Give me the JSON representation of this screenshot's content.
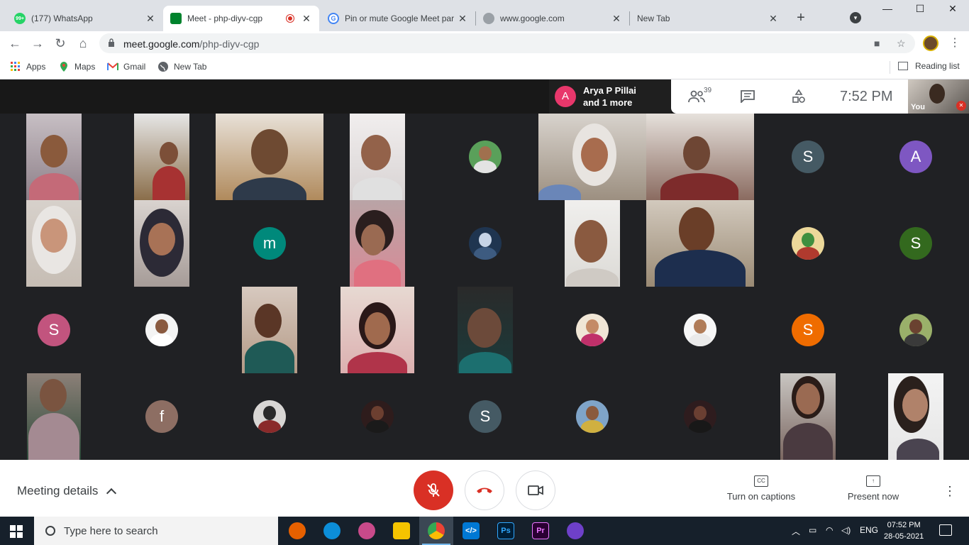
{
  "browser": {
    "tabs": [
      {
        "title": "(177) WhatsApp",
        "favicon": "whatsapp-icon",
        "favicon_color": "#25d366",
        "favicon_text": "99+"
      },
      {
        "title": "Meet - php-diyv-cgp",
        "favicon": "meet-icon",
        "favicon_color": "#00832d"
      },
      {
        "title": "Pin or mute Google Meet par",
        "favicon": "google-icon",
        "favicon_color": "#4285f4"
      },
      {
        "title": "www.google.com",
        "favicon": "globe-icon",
        "favicon_color": "#5f6368"
      },
      {
        "title": "New Tab",
        "favicon": "",
        "favicon_color": ""
      }
    ],
    "url_host": "meet.google.com",
    "url_path": "/php-diyv-cgp",
    "bookmarks": [
      {
        "label": "Apps",
        "icon": "apps-grid-icon"
      },
      {
        "label": "Maps",
        "icon": "maps-icon"
      },
      {
        "label": "Gmail",
        "icon": "gmail-icon"
      },
      {
        "label": "New Tab",
        "icon": "globe-icon"
      }
    ],
    "reading_list": "Reading list"
  },
  "meet": {
    "speaker": {
      "initial": "A",
      "name_line1": "Arya P Pillai",
      "name_line2": "and 1 more",
      "color": "#e8376b"
    },
    "participant_count": "39",
    "time": "7:52  PM",
    "self_label": "You",
    "avatars": [
      {
        "letter": "S",
        "color": "#455a64"
      },
      {
        "letter": "A",
        "color": "#7e57c2"
      },
      {
        "letter": "m",
        "color": "#00897b"
      },
      {
        "letter": "S",
        "color": "#33691e"
      },
      {
        "letter": "S",
        "color": "#c2547e"
      },
      {
        "letter": "S",
        "color": "#ef6c00"
      },
      {
        "letter": "f",
        "color": "#8d6e63"
      },
      {
        "letter": "S",
        "color": "#455a64"
      }
    ],
    "meeting_details": "Meeting details",
    "captions_label": "Turn on captions",
    "present_label": "Present now"
  },
  "taskbar": {
    "search_placeholder": "Type here to search",
    "language": "ENG",
    "clock_time": "07:52 PM",
    "clock_date": "28-05-2021",
    "apps": [
      {
        "name": "firefox-icon",
        "color": "#e66000"
      },
      {
        "name": "edge-icon",
        "color": "#0c8ed9"
      },
      {
        "name": "paint-icon",
        "color": "#c84a8a"
      },
      {
        "name": "file-explorer-icon",
        "color": "#f5c400"
      },
      {
        "name": "chrome-icon",
        "color": "#4285f4"
      },
      {
        "name": "vscode-icon",
        "color": "#0078d4"
      },
      {
        "name": "photoshop-icon",
        "color": "#001e36",
        "label": "Ps"
      },
      {
        "name": "premiere-icon",
        "color": "#2a0033",
        "label": "Pr"
      },
      {
        "name": "github-icon",
        "color": "#6e40c9"
      }
    ]
  }
}
